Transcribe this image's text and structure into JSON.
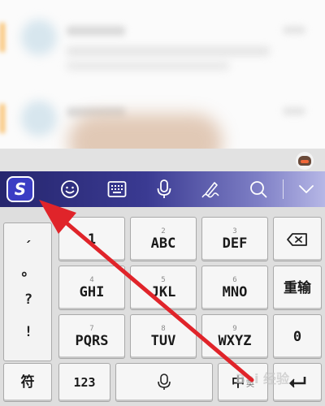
{
  "keyboard": {
    "toolbar": {
      "logo_letter": "S",
      "icons": [
        "emoji-icon",
        "keyboard-icon",
        "microphone-icon",
        "handwriting-icon",
        "search-icon",
        "chevron-down-icon"
      ]
    },
    "punctuation": [
      "ˏ",
      "。",
      "?",
      "!"
    ],
    "keys": {
      "k1": {
        "num": "",
        "label": "1"
      },
      "k2": {
        "num": "2",
        "label": "ABC"
      },
      "k3": {
        "num": "3",
        "label": "DEF"
      },
      "k4": {
        "num": "4",
        "label": "GHI"
      },
      "k5": {
        "num": "5",
        "label": "JKL"
      },
      "k6": {
        "num": "6",
        "label": "MNO"
      },
      "k7": {
        "num": "7",
        "label": "PQRS"
      },
      "k8": {
        "num": "8",
        "label": "TUV"
      },
      "k9": {
        "num": "9",
        "label": "WXYZ"
      },
      "reenter": "重输",
      "zero": "0",
      "symbol": "符",
      "num123": "123",
      "lang_switch": "中",
      "lang_sub": "英"
    },
    "watermark": "Bai 经验"
  },
  "colors": {
    "toolbar_start": "#26266e",
    "toolbar_end": "#b6b7e6",
    "arrow": "#e0242a",
    "logo_bg": "#3b3dc4"
  }
}
